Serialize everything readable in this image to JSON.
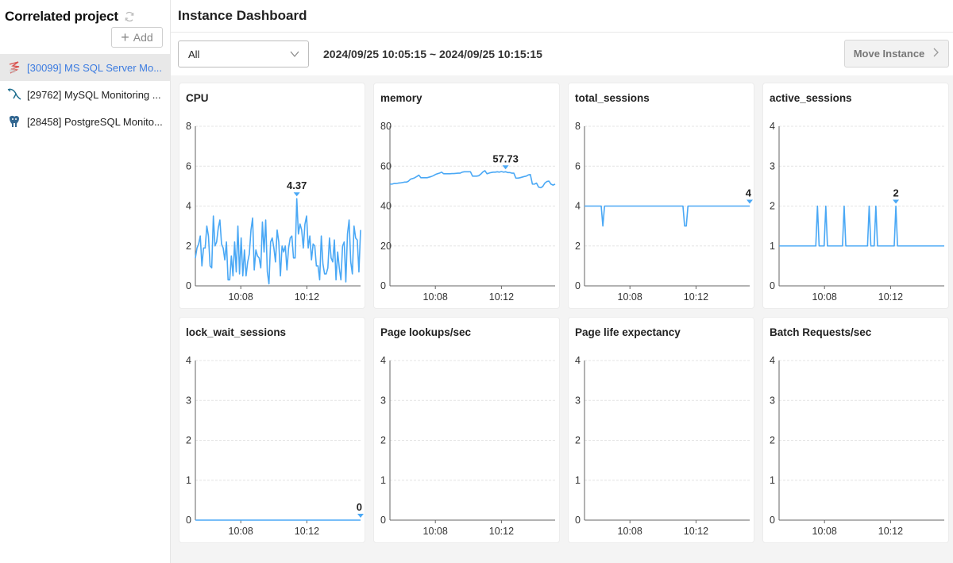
{
  "sidebar": {
    "title": "Correlated project",
    "refresh_icon": "refresh-icon",
    "add_label": "Add",
    "projects": [
      {
        "label": "[30099] MS SQL Server Mo...",
        "icon": "mssql-icon",
        "active": true
      },
      {
        "label": "[29762] MySQL Monitoring ...",
        "icon": "mysql-icon",
        "active": false
      },
      {
        "label": "[28458] PostgreSQL Monito...",
        "icon": "postgresql-icon",
        "active": false
      }
    ]
  },
  "header": {
    "title": "Instance Dashboard"
  },
  "toolbar": {
    "select_value": "All",
    "time_range": "2024/09/25 10:05:15 ~ 2024/09/25 10:15:15",
    "move_label": "Move Instance"
  },
  "colors": {
    "series": "#4aa8f5",
    "active_link": "#3b7be0"
  },
  "chart_data": [
    {
      "type": "line",
      "title": "CPU",
      "ylim": [
        0,
        8
      ],
      "yticks": [
        0,
        2,
        4,
        6,
        8
      ],
      "xticks": [
        "10:08",
        "10:12"
      ],
      "x_range": [
        "10:05:15",
        "10:15:15"
      ],
      "max_label": "4.37",
      "max_value": 4.37,
      "max_index": 62,
      "values": [
        1.4,
        1.9,
        2.1,
        2.5,
        1.0,
        1.9,
        1.9,
        3.0,
        2.5,
        1.0,
        0.9,
        3.5,
        2.0,
        2.2,
        2.9,
        3.3,
        2.1,
        1.9,
        1.3,
        2.2,
        0.3,
        0.3,
        1.5,
        0.5,
        2.2,
        0.7,
        3.0,
        0.6,
        2.4,
        0.5,
        1.8,
        0.5,
        1.2,
        1.6,
        2.8,
        3.4,
        0.8,
        1.8,
        1.5,
        1.4,
        0.9,
        3.2,
        1.7,
        3.3,
        0.7,
        0.1,
        2.2,
        2.4,
        1.9,
        1.2,
        2.8,
        2.2,
        0.5,
        2.0,
        1.7,
        2.0,
        0.8,
        1.9,
        2.4,
        2.5,
        1.4,
        1.4,
        4.37,
        2.6,
        3.1,
        2.8,
        1.9,
        3.1,
        3.5,
        1.9,
        2.5,
        1.3,
        2.1,
        2.0,
        1.0,
        1.0,
        0.3,
        2.5,
        1.1,
        0.6,
        0.6,
        0.9,
        2.4,
        1.4,
        1.2,
        2.3,
        0.3,
        1.7,
        0.9,
        0.3,
        2.0,
        2.2,
        0.2,
        2.6,
        3.3,
        1.2,
        0.6,
        3.0,
        2.4,
        2.3,
        0.7,
        2.8
      ]
    },
    {
      "type": "line",
      "title": "memory",
      "ylim": [
        0,
        80
      ],
      "yticks": [
        0,
        20,
        40,
        60,
        80
      ],
      "xticks": [
        "10:08",
        "10:12"
      ],
      "x_range": [
        "10:05:15",
        "10:15:15"
      ],
      "max_label": "57.73",
      "max_value": 57.73,
      "max_index": 56,
      "values": [
        51,
        51,
        51.3,
        51.3,
        51.5,
        51.6,
        51.8,
        52,
        52,
        52.5,
        53.5,
        53.8,
        54.2,
        54.8,
        55.5,
        54.2,
        54.2,
        54.2,
        54.2,
        54.5,
        54.8,
        55.2,
        55.8,
        56.2,
        56.5,
        57,
        56.2,
        56.2,
        56.2,
        56.2,
        56.3,
        56.3,
        56.4,
        56.5,
        56.5,
        57,
        57.2,
        57.2,
        57.2,
        57.2,
        55,
        55,
        55,
        55.2,
        56,
        57.1,
        57.73,
        56.2,
        56.5,
        56.8,
        57,
        57,
        57.2,
        57.0,
        57.3,
        57.0,
        57.2,
        56.8,
        56.8,
        56.5,
        56.5,
        54,
        54,
        54.2,
        54.5,
        54.8,
        55,
        55.6,
        55.8,
        51,
        51,
        51.5,
        49.5,
        49.2,
        49.8,
        51.5,
        52.3,
        52.5,
        51,
        50.5,
        51
      ]
    },
    {
      "type": "line",
      "title": "total_sessions",
      "ylim": [
        0,
        8
      ],
      "yticks": [
        0,
        2,
        4,
        6,
        8
      ],
      "xticks": [
        "10:08",
        "10:12"
      ],
      "x_range": [
        "10:05:15",
        "10:15:15"
      ],
      "max_label": "4",
      "max_value": 4,
      "max_index": 99,
      "values": [
        4,
        4,
        4,
        4,
        4,
        4,
        4,
        4,
        4,
        4,
        4,
        3,
        4,
        4,
        4,
        4,
        4,
        4,
        4,
        4,
        4,
        4,
        4,
        4,
        4,
        4,
        4,
        4,
        4,
        4,
        4,
        4,
        4,
        4,
        4,
        4,
        4,
        4,
        4,
        4,
        4,
        4,
        4,
        4,
        4,
        4,
        4,
        4,
        4,
        4,
        4,
        4,
        4,
        4,
        4,
        4,
        4,
        4,
        4,
        4,
        3,
        3,
        4,
        4,
        4,
        4,
        4,
        4,
        4,
        4,
        4,
        4,
        4,
        4,
        4,
        4,
        4,
        4,
        4,
        4,
        4,
        4,
        4,
        4,
        4,
        4,
        4,
        4,
        4,
        4,
        4,
        4,
        4,
        4,
        4,
        4,
        4,
        4,
        4,
        4
      ]
    },
    {
      "type": "line",
      "title": "active_sessions",
      "ylim": [
        0,
        4
      ],
      "yticks": [
        0,
        1,
        2,
        3,
        4
      ],
      "xticks": [
        "10:08",
        "10:12"
      ],
      "x_range": [
        "10:05:15",
        "10:15:15"
      ],
      "max_label": "2",
      "max_value": 2,
      "max_index": 70,
      "values": [
        1,
        1,
        1,
        1,
        1,
        1,
        1,
        1,
        1,
        1,
        1,
        1,
        1,
        1,
        1,
        1,
        1,
        1,
        1,
        1,
        1,
        1,
        1,
        2,
        1,
        1,
        1,
        1,
        2,
        1,
        1,
        1,
        1,
        1,
        1,
        1,
        1,
        1,
        1,
        2,
        1,
        1,
        1,
        1,
        1,
        1,
        1,
        1,
        1,
        1,
        1,
        1,
        1,
        1,
        2,
        1,
        1,
        1,
        2,
        1,
        1,
        1,
        1,
        1,
        1,
        1,
        1,
        1,
        1,
        1,
        2,
        1,
        1,
        1,
        1,
        1,
        1,
        1,
        1,
        1,
        1,
        1,
        1,
        1,
        1,
        1,
        1,
        1,
        1,
        1,
        1,
        1,
        1,
        1,
        1,
        1,
        1,
        1,
        1,
        1
      ]
    },
    {
      "type": "line",
      "title": "lock_wait_sessions",
      "ylim": [
        0,
        4
      ],
      "yticks": [
        0,
        1,
        2,
        3,
        4
      ],
      "xticks": [
        "10:08",
        "10:12"
      ],
      "x_range": [
        "10:05:15",
        "10:15:15"
      ],
      "max_label": "0",
      "max_value": 0,
      "max_index": 99,
      "values": [
        0,
        0,
        0,
        0,
        0,
        0,
        0,
        0,
        0,
        0,
        0,
        0,
        0,
        0,
        0,
        0,
        0,
        0,
        0,
        0,
        0,
        0,
        0,
        0,
        0,
        0,
        0,
        0,
        0,
        0,
        0,
        0,
        0,
        0,
        0,
        0,
        0,
        0,
        0,
        0,
        0,
        0,
        0,
        0,
        0,
        0,
        0,
        0,
        0,
        0,
        0,
        0,
        0,
        0,
        0,
        0,
        0,
        0,
        0,
        0,
        0,
        0,
        0,
        0,
        0,
        0,
        0,
        0,
        0,
        0,
        0,
        0,
        0,
        0,
        0,
        0,
        0,
        0,
        0,
        0,
        0,
        0,
        0,
        0,
        0,
        0,
        0,
        0,
        0,
        0,
        0,
        0,
        0,
        0,
        0,
        0,
        0,
        0,
        0,
        0
      ]
    },
    {
      "type": "line",
      "title": "Page lookups/sec",
      "ylim": [
        0,
        4
      ],
      "yticks": [
        0,
        1,
        2,
        3,
        4
      ],
      "xticks": [
        "10:08",
        "10:12"
      ],
      "x_range": [
        "10:05:15",
        "10:15:15"
      ],
      "max_label": null,
      "values": []
    },
    {
      "type": "line",
      "title": "Page life expectancy",
      "ylim": [
        0,
        4
      ],
      "yticks": [
        0,
        1,
        2,
        3,
        4
      ],
      "xticks": [
        "10:08",
        "10:12"
      ],
      "x_range": [
        "10:05:15",
        "10:15:15"
      ],
      "max_label": null,
      "values": []
    },
    {
      "type": "line",
      "title": "Batch Requests/sec",
      "ylim": [
        0,
        4
      ],
      "yticks": [
        0,
        1,
        2,
        3,
        4
      ],
      "xticks": [
        "10:08",
        "10:12"
      ],
      "x_range": [
        "10:05:15",
        "10:15:15"
      ],
      "max_label": null,
      "values": []
    }
  ]
}
